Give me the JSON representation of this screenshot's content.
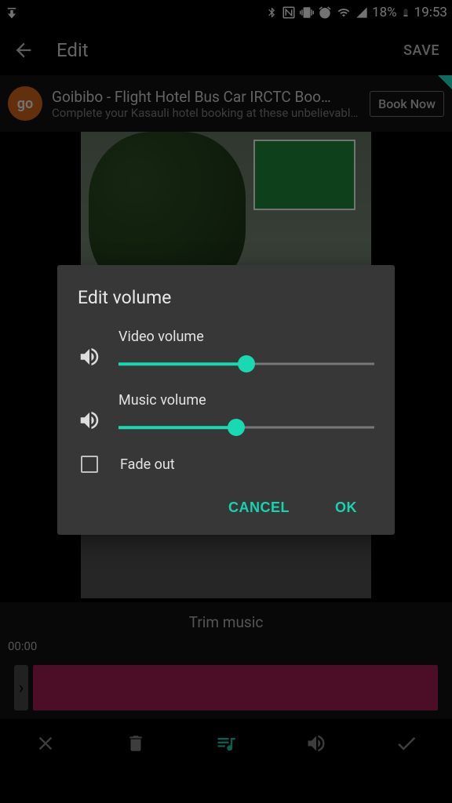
{
  "status": {
    "battery_pct": "18%",
    "time": "19:53"
  },
  "header": {
    "title": "Edit",
    "save": "SAVE"
  },
  "ad": {
    "logo_text": "go",
    "title": "Goibibo - Flight Hotel Bus Car IRCTC Boo…",
    "subtitle": "Complete your Kasauli hotel booking at these unbelievable …",
    "cta": "Book Now"
  },
  "trim": {
    "label": "Trim music",
    "time": "00:00"
  },
  "dialog": {
    "title": "Edit volume",
    "video": {
      "label": "Video volume",
      "value": 50
    },
    "music": {
      "label": "Music volume",
      "value": 46
    },
    "fade": {
      "label": "Fade out",
      "checked": false
    },
    "cancel": "CANCEL",
    "ok": "OK"
  }
}
